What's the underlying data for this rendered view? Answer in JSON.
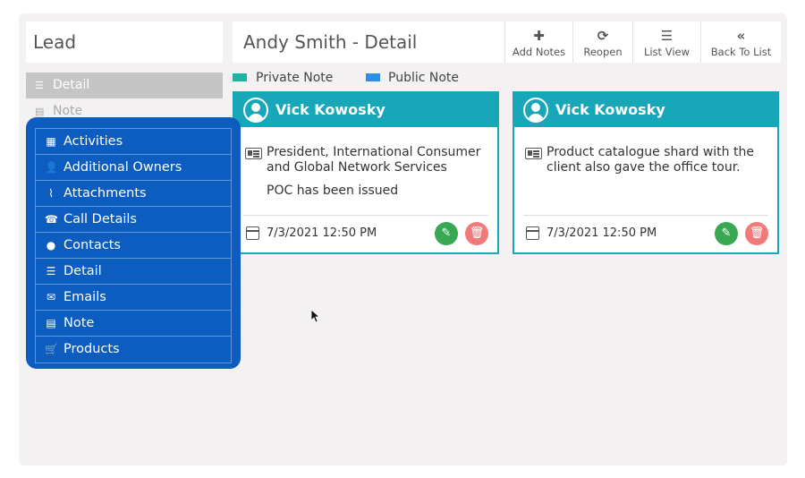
{
  "sidebar": {
    "title": "Lead",
    "active": {
      "label": "Detail",
      "icon": "list-icon"
    },
    "next": {
      "label": "Note",
      "icon": "file-icon"
    }
  },
  "header": {
    "title": "Andy Smith - Detail",
    "buttons": [
      {
        "label": "Add Notes",
        "icon": "plus-icon"
      },
      {
        "label": "Reopen",
        "icon": "refresh-icon"
      },
      {
        "label": "List View",
        "icon": "list-icon"
      },
      {
        "label": "Back To List",
        "icon": "double-chevron-left-icon"
      }
    ]
  },
  "legend": [
    {
      "label": "Private Note",
      "color": "#19b6a0"
    },
    {
      "label": "Public Note",
      "color": "#2d8fe3"
    }
  ],
  "notes": [
    {
      "author": "Vick Kowosky",
      "text": "President, International Consumer and Global Network Services",
      "extra": "POC has been issued",
      "date": "7/3/2021 12:50 PM"
    },
    {
      "author": "Vick Kowosky",
      "text": "Product catalogue shard with the client also gave the office tour.",
      "extra": "",
      "date": "7/3/2021 12:50 PM"
    }
  ],
  "menu": [
    {
      "label": "Activities",
      "icon": "calendar-icon"
    },
    {
      "label": "Additional Owners",
      "icon": "user-plus-icon"
    },
    {
      "label": "Attachments",
      "icon": "paperclip-icon"
    },
    {
      "label": "Call Details",
      "icon": "phone-icon"
    },
    {
      "label": "Contacts",
      "icon": "users-icon"
    },
    {
      "label": "Detail",
      "icon": "list-icon"
    },
    {
      "label": "Emails",
      "icon": "envelope-icon"
    },
    {
      "label": "Note",
      "icon": "file-icon"
    },
    {
      "label": "Products",
      "icon": "cart-icon"
    }
  ],
  "colors": {
    "accent": "#18a6b9",
    "menu": "#0d5cc0",
    "edit": "#38a852",
    "delete": "#f07a7a"
  }
}
